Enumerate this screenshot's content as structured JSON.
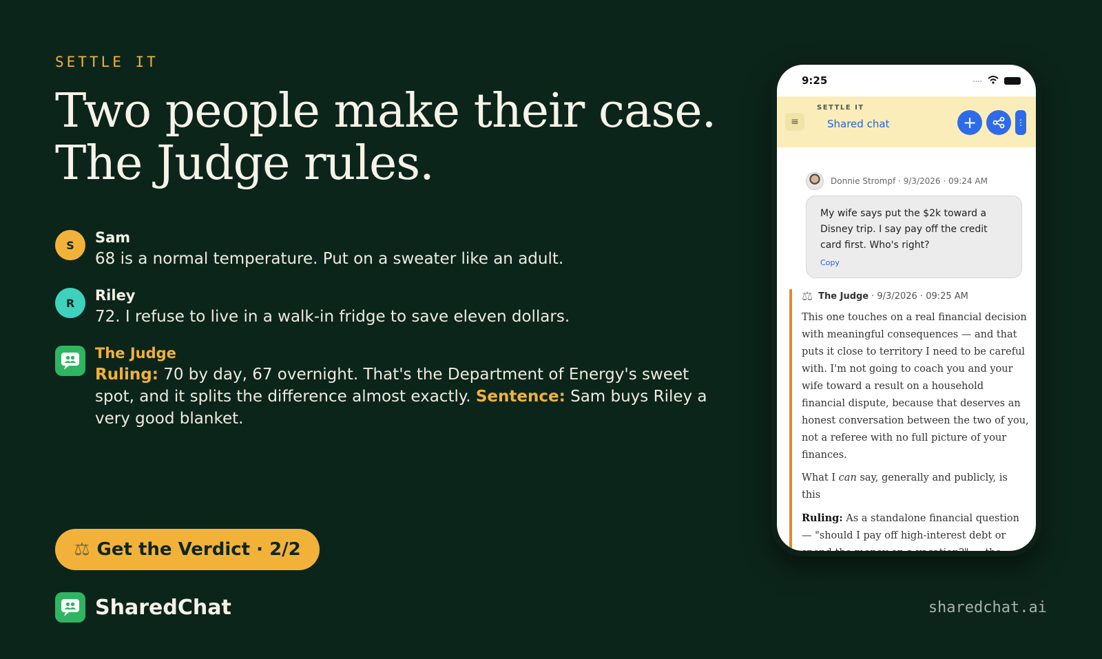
{
  "eyebrow": "SETTLE IT",
  "headline": "Two people make their case. The Judge rules.",
  "conversation": [
    {
      "initial": "S",
      "name": "Sam",
      "text": "68 is a normal temperature. Put on a sweater like an adult."
    },
    {
      "initial": "R",
      "name": "Riley",
      "text": "72. I refuse to live in a walk-in fridge to save eleven dollars."
    }
  ],
  "judge": {
    "name": "The Judge",
    "ruling_label": "Ruling:",
    "ruling_text": " 70 by day, 67 overnight. That's the Department of Energy's sweet spot, and it splits the difference almost exactly. ",
    "sentence_label": "Sentence:",
    "sentence_text": " Sam buys Riley a very good blanket."
  },
  "cta": {
    "label": "Get the Verdict · 2/2",
    "icon": "scale-icon"
  },
  "brand": {
    "name": "SharedChat",
    "icon": "chat-people-icon"
  },
  "domain": "sharedchat.ai",
  "phone": {
    "time": "9:25",
    "app_eyebrow": "SETTLE IT",
    "app_title": "Shared chat",
    "user_message": {
      "author": "Donnie Strompf · 9/3/2026 · 09:24 AM",
      "text": "My wife says put the $2k toward a Disney trip. I say pay off the credit card first. Who's right?",
      "copy_label": "Copy"
    },
    "judge_message": {
      "author": "The Judge",
      "timestamp": "· 9/3/2026 · 09:25 AM",
      "para1": "This one touches on a real financial decision with meaningful consequences — and that puts it close to territory I need to be careful with. I'm not going to coach you and your wife toward a result on a household financial dispute, because that deserves an honest conversation between the two of you, not a referee with no full picture of your finances.",
      "para2_prefix": "What I ",
      "para2_emph": "can",
      "para2_suffix": " say, generally and publicly, is this",
      "ruling_label": "Ruling:",
      "ruling_text": " As a standalone financial question — \"should I pay off high-interest debt or spend the money on a vacation?\" — the math almost always favors the debt. Credit card"
    }
  },
  "colors": {
    "background": "#0c251b",
    "accent": "#f2b23a",
    "teal": "#3ed2be",
    "green": "#2fb561",
    "phone_blue": "#2e6bea"
  }
}
